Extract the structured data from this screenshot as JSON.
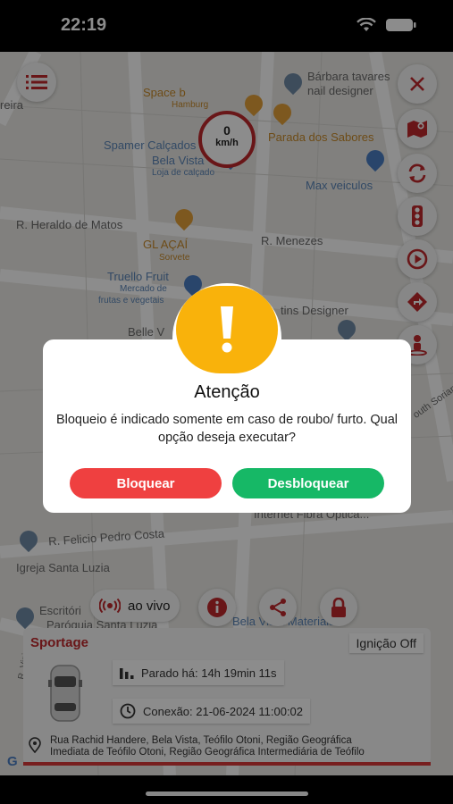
{
  "status_bar": {
    "time": "22:19"
  },
  "map": {
    "labels": {
      "barbara": "Bárbara tavares",
      "nail": "nail designer",
      "space": "Space b",
      "hamburg": "Hamburg",
      "parada": "Parada dos Sabores",
      "spamer": "Spamer Calçados",
      "bela_vista": "Bela Vista",
      "loja": "Loja de calçado",
      "max": "Max veiculos",
      "heraldo": "R. Heraldo de Matos",
      "menezes": "R. Menezes",
      "acai": "GL AÇAÍ",
      "sorvete": "Sorvete",
      "truello": "Truello Fruit",
      "mercado": "Mercado de",
      "frutas": "frutas e vegetais",
      "designer": "tins Designer",
      "belle": "Belle V",
      "south": "outh Soriano",
      "internet": "Internet Fibra Óptica...",
      "felicio": "R. Felicio Pedro Costa",
      "igreja": "Igreja Santa Luzia",
      "escritorio": "Escritóri",
      "paroquia": "Paróquia Santa Luzia",
      "bela_materiais": "Bela Vista Materiais",
      "side_street": "R. Vinic",
      "ira": "reira"
    }
  },
  "speed": {
    "value": "0",
    "unit": "km/h"
  },
  "live": {
    "label": "ao vivo"
  },
  "vehicle": {
    "name": "Sportage",
    "ignition": "Ignição Off",
    "stopped": "Parado há: 14h 19min 11s",
    "connection": "Conexão: 21-06-2024 11:00:02",
    "address_line1": "Rua Rachid Handere, Bela Vista, Teófilo Otoni, Região Geográfica",
    "address_line2": "Imediata de Teófilo Otoni, Região Geográfica Intermediária de Teófilo"
  },
  "dialog": {
    "title": "Atenção",
    "message": "Bloqueio é indicado somente em caso de roubo/ furto. Qual opção deseja executar?",
    "block_label": "Bloquear",
    "unblock_label": "Desbloquear"
  },
  "colors": {
    "accent_red": "#c0282d",
    "warning": "#f9b20b",
    "block": "#ef4040",
    "unblock": "#16b866"
  }
}
